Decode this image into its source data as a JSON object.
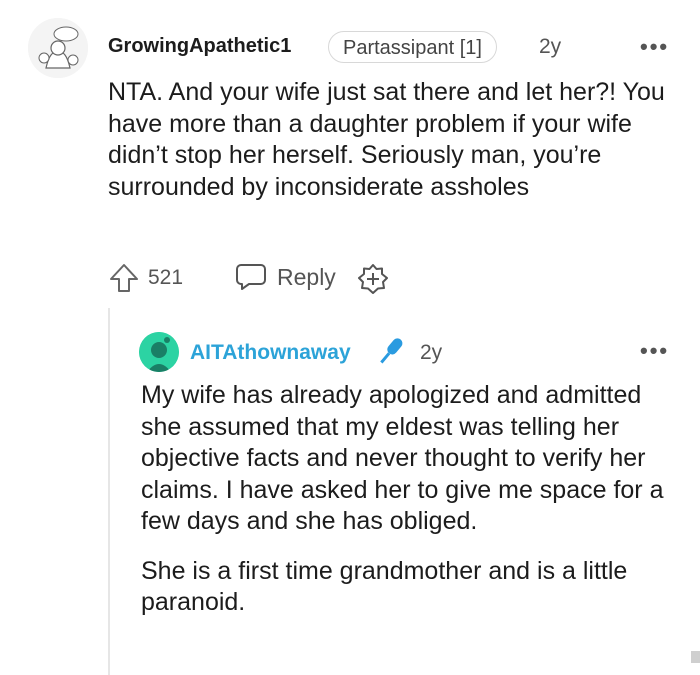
{
  "comment": {
    "username": "GrowingApathetic1",
    "flair": "Partassipant [1]",
    "time": "2y",
    "more": "•••",
    "text": "NTA. And your wife just sat there and let her?! You have more than a daughter problem if your wife didn’t stop her herself. Seriously man, you’re surrounded by inconsiderate assholes",
    "votes": "521",
    "reply_label": "Reply"
  },
  "reply": {
    "username": "AITAthownaway",
    "time": "2y",
    "more": "•••",
    "paragraphs": [
      "My wife has already apologized and admitted she assumed that my eldest was telling her objective facts and never thought to verify her claims. I have asked her to give me space for a few days and she has obliged.",
      "She is a first time grandmother and is a little paranoid."
    ]
  },
  "colors": {
    "op_username": "#2ca3d8",
    "avatar_green": "#2cd3a3",
    "mic": "#2a9be0"
  },
  "icons": [
    "upvote-icon",
    "reply-bubble-icon",
    "award-plus-icon",
    "mic-icon",
    "more-icon"
  ]
}
